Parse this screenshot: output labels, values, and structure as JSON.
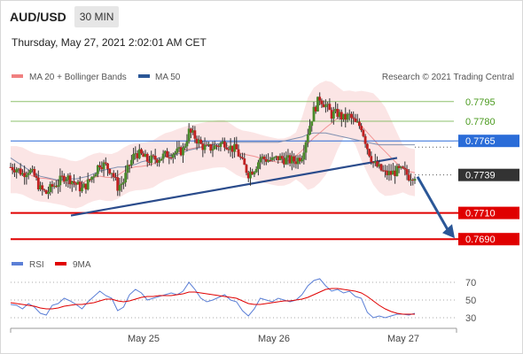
{
  "header": {
    "symbol": "AUD/USD",
    "timeframe": "30 MIN",
    "datetime": "Thursday, May 27, 2021 2:02:01 AM CET"
  },
  "legend": {
    "items": [
      {
        "label": "MA 20 + Bollinger Bands",
        "color": "#f08080"
      },
      {
        "label": "MA 50",
        "color": "#2b5797"
      }
    ],
    "credit": "Research © 2021 Trading Central"
  },
  "rsi_legend": {
    "items": [
      {
        "label": "RSI",
        "color": "#5b7fd6"
      },
      {
        "label": "9MA",
        "color": "#e00000"
      }
    ]
  },
  "chart_data": [
    {
      "type": "candlestick",
      "title": "AUD/USD 30 MIN",
      "xlabel": "",
      "ylabel": "",
      "x_ticks": [
        "May 25",
        "May 26",
        "May 27"
      ],
      "ylim": [
        0.768,
        0.7805
      ],
      "levels": [
        {
          "value": 0.7795,
          "label": "0.7795",
          "kind": "resistance",
          "color": "#8ec06c"
        },
        {
          "value": 0.778,
          "label": "0.7780",
          "kind": "resistance",
          "color": "#8ec06c"
        },
        {
          "value": 0.7765,
          "label": "0.7765",
          "kind": "pivot",
          "color": "#2a6cd8"
        },
        {
          "value": 0.7739,
          "label": "0.7739",
          "kind": "last",
          "color": "#333333"
        },
        {
          "value": 0.771,
          "label": "0.7710",
          "kind": "support",
          "color": "#e00000"
        },
        {
          "value": 0.769,
          "label": "0.7690",
          "kind": "support",
          "color": "#e00000"
        }
      ],
      "close_path": [
        0.7745,
        0.7744,
        0.774,
        0.7743,
        0.7738,
        0.7728,
        0.7725,
        0.773,
        0.7733,
        0.7738,
        0.7736,
        0.7732,
        0.7728,
        0.7733,
        0.774,
        0.7748,
        0.7746,
        0.7742,
        0.773,
        0.7734,
        0.7747,
        0.7756,
        0.7754,
        0.775,
        0.7751,
        0.7752,
        0.7754,
        0.7756,
        0.7756,
        0.7758,
        0.7772,
        0.7768,
        0.7762,
        0.7759,
        0.776,
        0.7762,
        0.7764,
        0.776,
        0.7758,
        0.7748,
        0.774,
        0.7744,
        0.7752,
        0.7751,
        0.775,
        0.7752,
        0.7751,
        0.775,
        0.775,
        0.7754,
        0.7772,
        0.7788,
        0.7798,
        0.7792,
        0.7785,
        0.7786,
        0.7782,
        0.7784,
        0.7778,
        0.7776,
        0.776,
        0.7748,
        0.7744,
        0.774,
        0.774,
        0.7742,
        0.7742,
        0.7738,
        0.7739
      ],
      "ma50_path": [
        0.7752,
        0.7749,
        0.7746,
        0.7743,
        0.774,
        0.7738,
        0.7737,
        0.7736,
        0.7735,
        0.7735,
        0.7736,
        0.7736,
        0.7737,
        0.7738,
        0.774,
        0.7742,
        0.7743,
        0.7744,
        0.7745,
        0.7745,
        0.7746,
        0.7747,
        0.7749,
        0.775,
        0.7751,
        0.7752,
        0.7753,
        0.7754,
        0.7755,
        0.7756,
        0.7758,
        0.7759,
        0.776,
        0.7761,
        0.7762,
        0.7763,
        0.7764,
        0.7764,
        0.7764,
        0.7764,
        0.7764,
        0.7764,
        0.7764,
        0.7764,
        0.7764,
        0.7764,
        0.7765,
        0.7766,
        0.7767,
        0.7768,
        0.777,
        0.7771,
        0.7771,
        0.7771,
        0.777,
        0.7769,
        0.7768,
        0.7767,
        0.7766,
        0.7765,
        0.7764,
        0.7763,
        0.7762,
        0.7762,
        0.7762,
        0.7762,
        0.7762,
        0.7762,
        0.7762
      ],
      "trendline": {
        "start": 0.7708,
        "end": 0.7752
      }
    },
    {
      "type": "line",
      "title": "RSI",
      "ylim": [
        24,
        76
      ],
      "y_ticks": [
        70,
        50,
        30
      ],
      "series": [
        {
          "name": "RSI",
          "color": "#5b7fd6",
          "values": [
            45,
            44,
            40,
            46,
            42,
            35,
            33,
            44,
            46,
            52,
            49,
            45,
            40,
            48,
            54,
            60,
            55,
            52,
            38,
            42,
            56,
            62,
            58,
            50,
            52,
            54,
            56,
            58,
            56,
            60,
            70,
            62,
            52,
            48,
            50,
            53,
            56,
            50,
            48,
            38,
            32,
            40,
            52,
            50,
            48,
            52,
            50,
            48,
            50,
            56,
            66,
            72,
            74,
            66,
            60,
            62,
            58,
            60,
            54,
            52,
            36,
            30,
            32,
            30,
            32,
            34,
            34,
            33,
            35
          ]
        },
        {
          "name": "9MA",
          "color": "#e00000",
          "values": [
            47,
            46,
            45,
            44,
            43,
            41,
            40,
            40,
            41,
            43,
            44,
            45,
            45,
            46,
            47,
            49,
            51,
            51,
            49,
            48,
            49,
            51,
            53,
            54,
            54,
            55,
            55,
            55,
            56,
            57,
            59,
            59,
            58,
            57,
            56,
            55,
            54,
            53,
            52,
            49,
            46,
            45,
            45,
            46,
            47,
            48,
            49,
            49,
            50,
            51,
            53,
            56,
            59,
            62,
            63,
            63,
            62,
            61,
            60,
            58,
            54,
            49,
            44,
            40,
            37,
            35,
            34,
            34,
            34
          ]
        }
      ]
    }
  ]
}
